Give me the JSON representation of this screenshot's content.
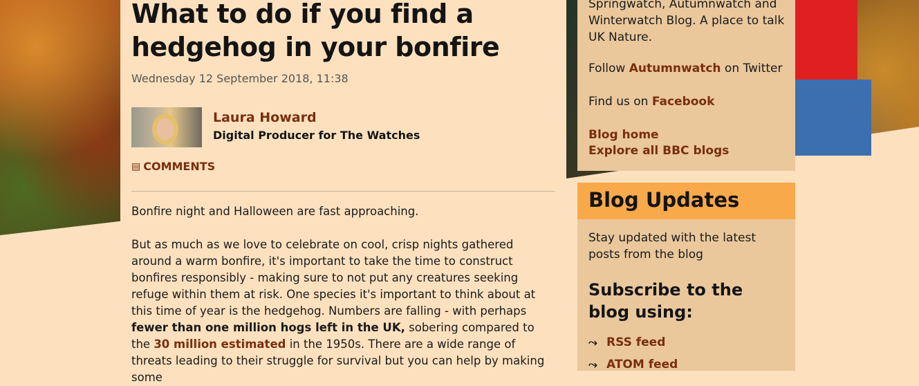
{
  "article": {
    "title": "What to do if you find a hedgehog in your bonfire",
    "date": "Wednesday 12 September 2018, 11:38",
    "author_name": "Laura Howard",
    "author_role": "Digital Producer for The Watches",
    "comments_label": "COMMENTS",
    "para1": "Bonfire night and Halloween are fast approaching.",
    "para2": {
      "part1": "But as much as we love to celebrate on cool, crisp nights gathered around a warm bonfire, it's important to take the time to construct bonfires responsibly - making sure to not put any creatures seeking refuge within them at risk. One species it's important to think about at this time of year is the hedgehog. Numbers are falling - with perhaps ",
      "bold": "fewer than one million hogs left in the UK,",
      "part2": " sobering compared to the ",
      "link": "30 million estimated",
      "part3": " in the 1950s. There are a wide range of threats leading to their struggle for survival but you can help by making some"
    }
  },
  "sidebar": {
    "about": "Springwatch, Autumnwatch and Winterwatch Blog. A place to talk UK Nature.",
    "follow_prefix": "Follow ",
    "follow_link": "Autumnwatch",
    "follow_suffix": " on Twitter",
    "find_prefix": "Find us on ",
    "find_link": "Facebook",
    "blog_home": "Blog home",
    "explore": "Explore all BBC blogs",
    "updates_title": "Blog Updates",
    "updates_text": "Stay updated with the latest posts from the blog",
    "subscribe_title": "Subscribe to the blog using:",
    "feeds": [
      "RSS feed",
      "ATOM feed"
    ]
  },
  "colors": {
    "accent": "#7a2e0e",
    "page_bg": "#fde1bf",
    "sidebar_bg": "#eac89c",
    "updates_header": "#f8a94a"
  },
  "icons": {
    "comments": "comment-icon",
    "feed": "rss-icon"
  }
}
